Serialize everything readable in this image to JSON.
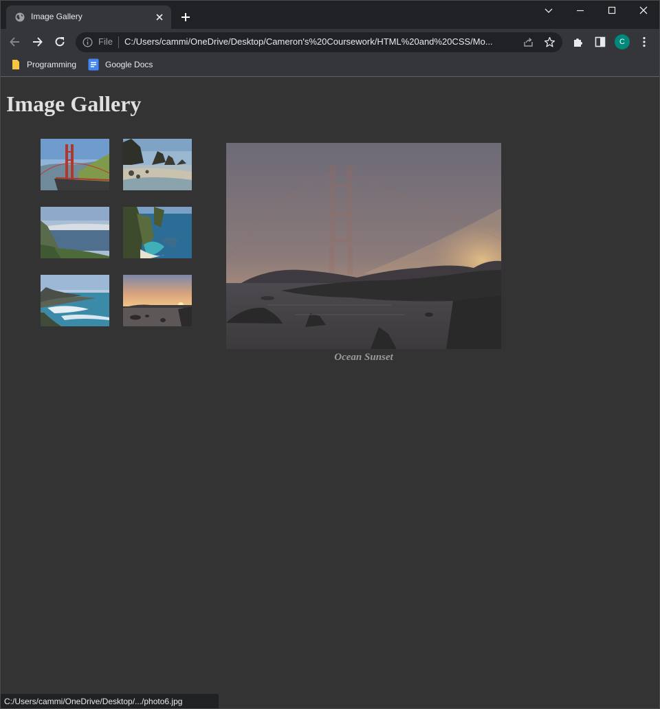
{
  "browser": {
    "tab": {
      "title": "Image Gallery",
      "favicon": "globe-icon"
    },
    "address": {
      "scheme": "File",
      "url": "C:/Users/cammi/OneDrive/Desktop/Cameron's%20Coursework/HTML%20and%20CSS/Mo..."
    },
    "profile_initial": "C",
    "bookmarks": [
      {
        "label": "Programming",
        "icon": "folder-icon"
      },
      {
        "label": "Google Docs",
        "icon": "docs-icon"
      }
    ],
    "status_text": "C:/Users/cammi/OneDrive/Desktop/.../photo6.jpg",
    "colors": {
      "frame": "#202124",
      "toolbar": "#35363a",
      "avatar": "#00897b"
    }
  },
  "page": {
    "title": "Image Gallery",
    "caption": "Ocean Sunset",
    "background": "#333333"
  }
}
